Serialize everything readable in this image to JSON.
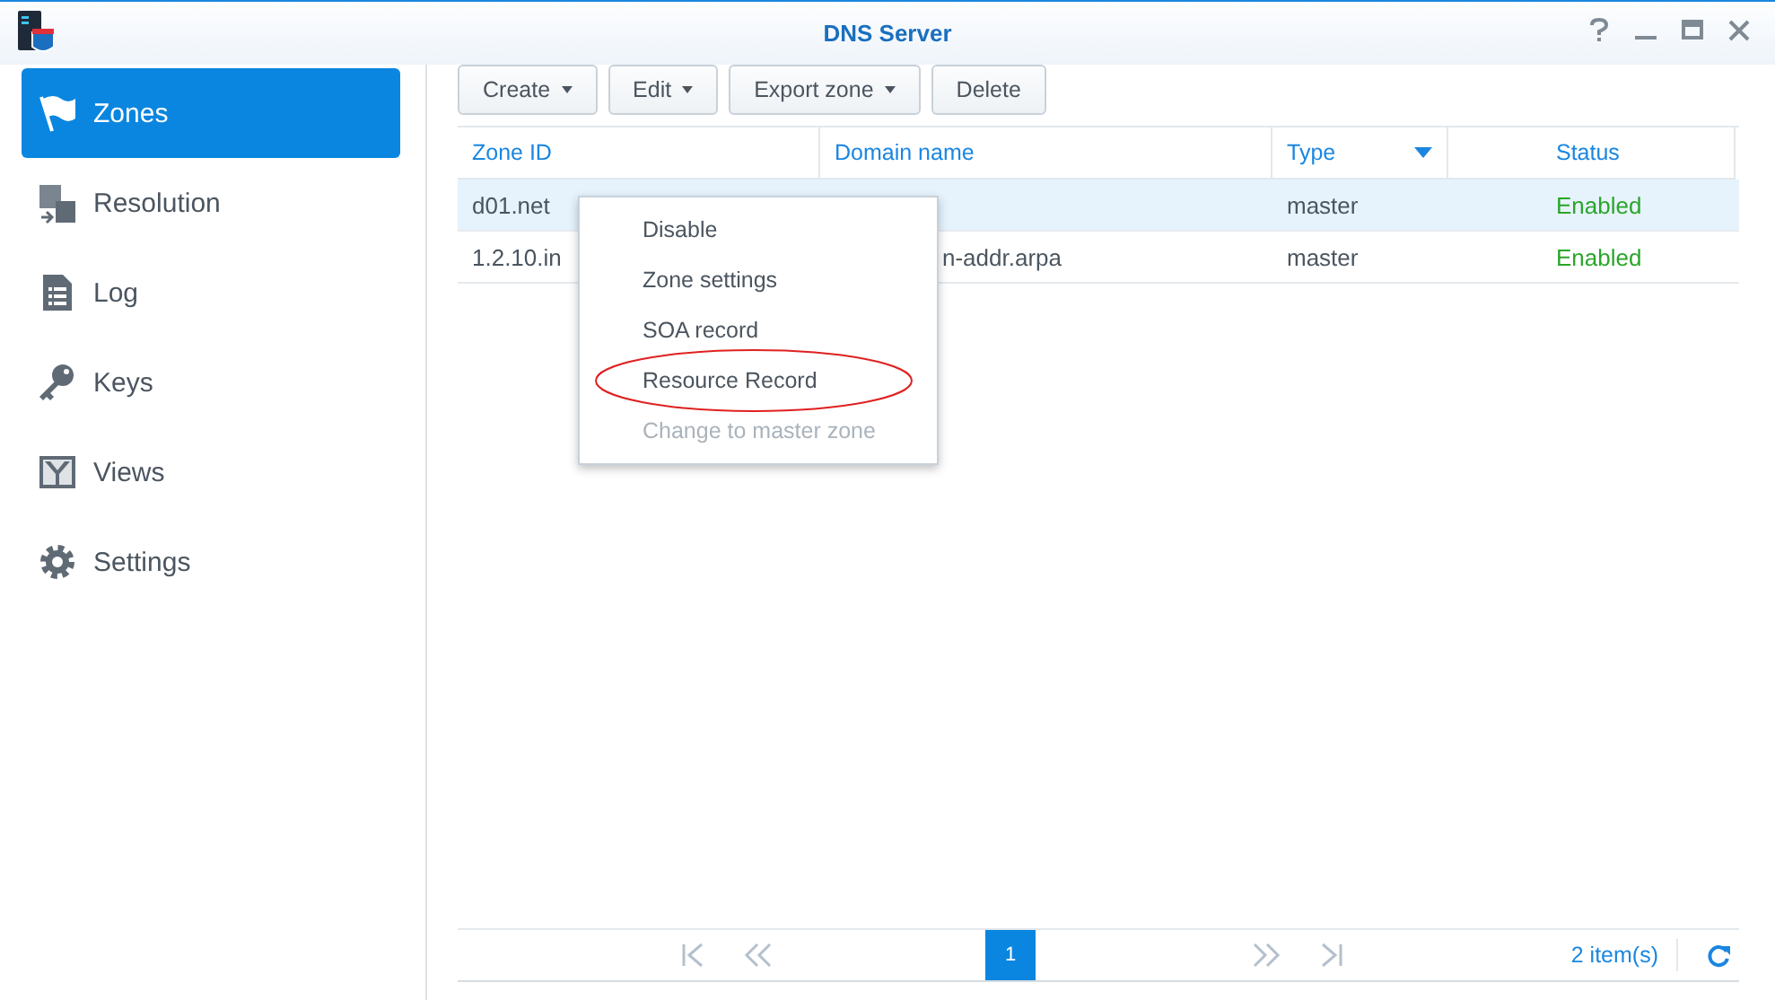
{
  "window": {
    "title": "DNS Server"
  },
  "sidebar": {
    "items": [
      {
        "label": "Zones",
        "kind": "flag",
        "selected": true
      },
      {
        "label": "Resolution",
        "kind": "resolution",
        "selected": false
      },
      {
        "label": "Log",
        "kind": "log",
        "selected": false
      },
      {
        "label": "Keys",
        "kind": "key",
        "selected": false
      },
      {
        "label": "Views",
        "kind": "views",
        "selected": false
      },
      {
        "label": "Settings",
        "kind": "gear",
        "selected": false
      }
    ]
  },
  "toolbar": [
    {
      "label": "Create",
      "dropdown": true
    },
    {
      "label": "Edit",
      "dropdown": true
    },
    {
      "label": "Export zone",
      "dropdown": true
    },
    {
      "label": "Delete",
      "dropdown": false
    }
  ],
  "table": {
    "columns": [
      {
        "label": "Zone ID",
        "sorted": false
      },
      {
        "label": "Domain name",
        "sorted": false
      },
      {
        "label": "Type",
        "sorted": true
      },
      {
        "label": "Status",
        "sorted": false
      }
    ],
    "rows": [
      {
        "zone_id": "d01.net",
        "type": "master",
        "status": "Enabled",
        "selected": true
      },
      {
        "zone_id": "1.2.10.in",
        "domain_name": "n-addr.arpa",
        "type": "master",
        "status": "Enabled",
        "selected": false
      }
    ]
  },
  "context_menu": {
    "items": [
      {
        "label": "Disable",
        "disabled": false,
        "annotated": false
      },
      {
        "label": "Zone settings",
        "disabled": false,
        "annotated": false
      },
      {
        "label": "SOA record",
        "disabled": false,
        "annotated": false
      },
      {
        "label": "Resource Record",
        "disabled": false,
        "annotated": true
      },
      {
        "label": "Change to master zone",
        "disabled": true,
        "annotated": false
      }
    ]
  },
  "pager": {
    "current_page": "1",
    "count": "2 item(s)"
  }
}
